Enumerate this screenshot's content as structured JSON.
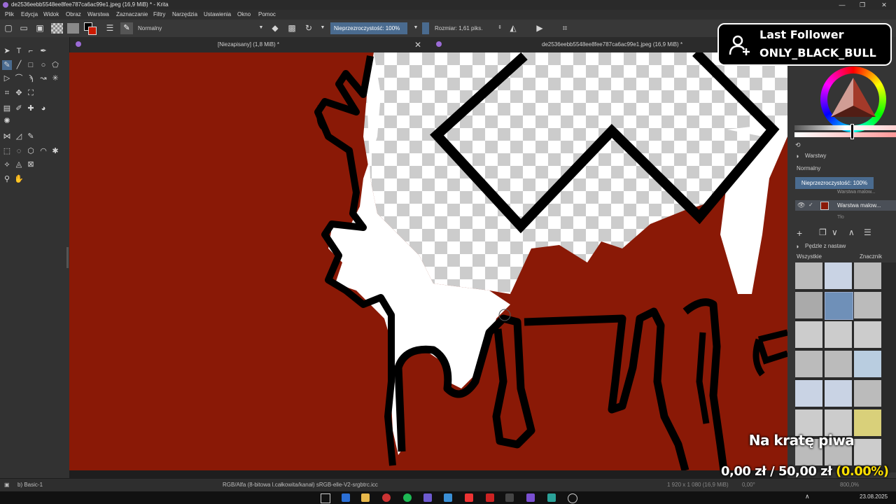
{
  "window": {
    "title": "de2536eebb5548ee8fee787ca6ac99e1.jpeg (16,9 MiB) * - Krita",
    "controls": [
      "—",
      "❐",
      "✕"
    ]
  },
  "menu": [
    "Plik",
    "Edycja",
    "Widok",
    "Obraz",
    "Warstwa",
    "Zaznaczanie",
    "Filtry",
    "Narzędzia",
    "Ustawienia",
    "Okno",
    "Pomoc"
  ],
  "toolbar": {
    "blend_mode": "Normalny",
    "opacity": "Nieprzezroczystość: 100%",
    "size": "Rozmiar: 1,61 piks."
  },
  "tabs": [
    {
      "label": "[Niezapisany] (1,8 MiB) *"
    },
    {
      "label": "de2536eebb5548ee8fee787ca6ac99e1.jpeg (16,9 MiB) *"
    }
  ],
  "layers_docker": {
    "title": "Warstwy",
    "blend_mode": "Normalny",
    "opacity": "Nieprzezroczystość: 100%",
    "layers": [
      {
        "name": "Warstwa malow..."
      },
      {
        "name": "Warstwa malow..."
      },
      {
        "name": "Tło"
      }
    ]
  },
  "brushes_docker": {
    "title": "Pędzle z nastaw",
    "filter": "Wszystkie",
    "tag_label": "Znacznik"
  },
  "status": {
    "preset": "b) Basic-1",
    "color_space": "RGB/Alfa (8-bitowa l.całkowita/kanał)  sRGB-elle-V2-srgbtrc.icc",
    "dimensions": "1 920 x 1 080 (16,9 MiB)",
    "angle": "0,00°",
    "zoom": "800,0%"
  },
  "taskbar": {
    "date": "23.08.2025"
  },
  "overlay": {
    "follower_title": "Last Follower",
    "follower_name": "ONLY_BLACK_BULL",
    "goal_title": "Na kratę piwa",
    "goal_current": "0,00 zł",
    "goal_separator": "/",
    "goal_target": "50,00 zł",
    "goal_percent": "(0.00%)"
  },
  "colors": {
    "canvas_background": "#8a1906",
    "stroke": "#000000",
    "fill": "#ffffff",
    "active_layer": "#4a6b8f",
    "accent_yellow": "#ffe000"
  }
}
